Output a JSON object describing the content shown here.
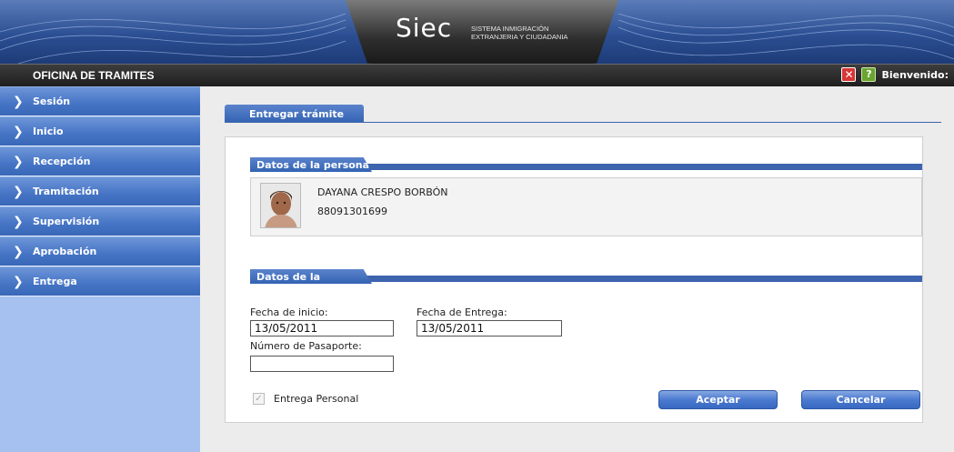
{
  "header": {
    "logo": "Siec",
    "logo_subtitle_line1": "SISTEMA INMIGRACIÓN",
    "logo_subtitle_line2": "EXTRANJERIA Y CIUDADANIA",
    "office_title": "OFICINA DE TRAMITES",
    "welcome": "Bienvenido:",
    "close_icon": "close-icon",
    "help_icon": "help-icon"
  },
  "sidebar": {
    "items": [
      {
        "label": "Sesión"
      },
      {
        "label": "Inicio"
      },
      {
        "label": "Recepción"
      },
      {
        "label": "Tramitación"
      },
      {
        "label": "Supervisión"
      },
      {
        "label": "Aprobación"
      },
      {
        "label": "Entrega"
      }
    ]
  },
  "main": {
    "tab": "Entregar trámite",
    "person_section": "Datos de la persona",
    "person": {
      "name": "DAYANA CRESPO BORBÓN",
      "id": "88091301699"
    },
    "request_section": "Datos de la Solicitud",
    "fecha_inicio_label": "Fecha de inicio:",
    "fecha_inicio_value": "13/05/2011",
    "fecha_entrega_label": "Fecha de Entrega:",
    "fecha_entrega_value": "13/05/2011",
    "pasaporte_label": "Número de Pasaporte:",
    "pasaporte_value": "",
    "entrega_personal_label": "Entrega Personal",
    "entrega_personal_checked": true,
    "aceptar": "Aceptar",
    "cancelar": "Cancelar"
  },
  "colors": {
    "accent": "#3363b3",
    "sidebar_bg": "#a6c1ef",
    "topbar": "#1e1e1e"
  }
}
